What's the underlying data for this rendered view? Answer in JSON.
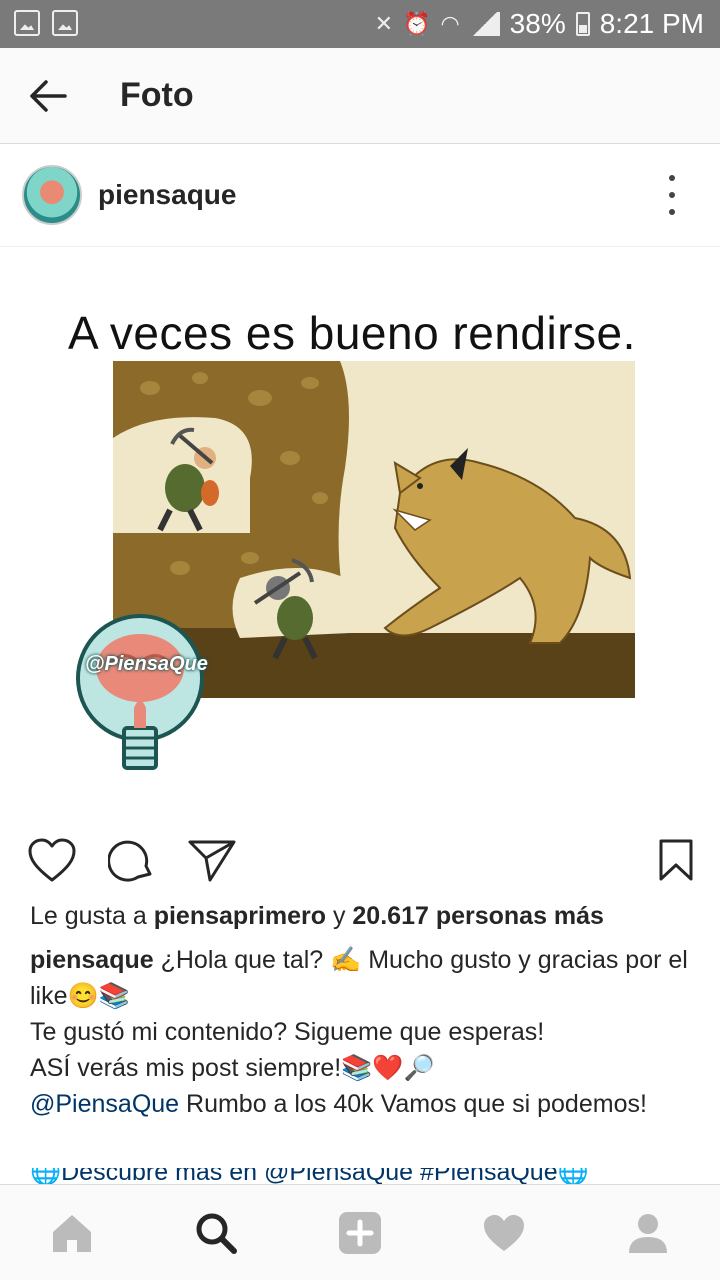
{
  "status_bar": {
    "battery": "38%",
    "time": "8:21 PM"
  },
  "app_bar": {
    "title": "Foto"
  },
  "post": {
    "username": "piensaque",
    "image_text": "A veces es bueno rendirse.",
    "watermark_text": "@PiensaQue"
  },
  "likes": {
    "prefix": "Le gusta a ",
    "liker": "piensaprimero",
    "middle": " y ",
    "count_text": "20.617 personas más"
  },
  "caption": {
    "username": "piensaque",
    "line1": "¿Hola que tal? ✍ Mucho gusto y gracias por el like😊📚",
    "line2": "Te gustó mi contenido?  Sigueme que esperas!",
    "line3": "ASÍ verás mis post siempre!📚❤️🔎",
    "mention": "@PiensaQue",
    "line4": " Rumbo a los 40k Vamos que si podemos!",
    "line5": "🌐Descubre mas en @PiensaQue #PiensaQue🌐"
  },
  "icons": {
    "back": "arrow-left-icon",
    "more": "more-vertical-icon",
    "like": "heart-icon",
    "comment": "comment-icon",
    "share": "send-icon",
    "save": "bookmark-icon",
    "home": "home-icon",
    "search": "search-icon",
    "add": "add-icon",
    "activity": "heart-icon",
    "profile": "profile-icon"
  }
}
